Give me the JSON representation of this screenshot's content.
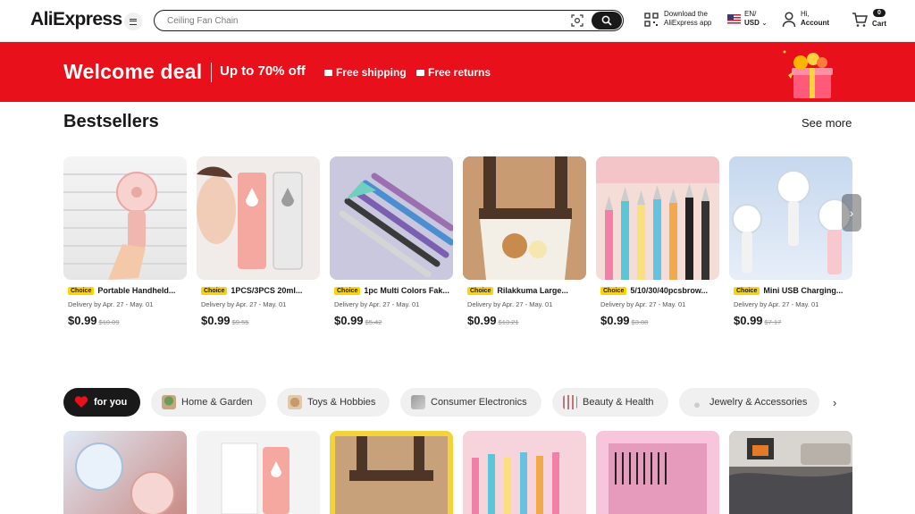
{
  "header": {
    "logo": "AliExpress",
    "search_placeholder": "Ceiling Fan Chain",
    "app_line1": "Download the",
    "app_line2": "AliExpress app",
    "lang_line1": "EN/",
    "lang_line2": "USD",
    "account_line1": "Hi,",
    "account_line2": "Account",
    "cart_count": "0",
    "cart_label": "Cart"
  },
  "banner": {
    "title": "Welcome deal",
    "subtitle": "Up to 70% off",
    "free_shipping": "Free shipping",
    "free_returns": "Free returns"
  },
  "bestsellers": {
    "title": "Bestsellers",
    "see_more": "See more",
    "products": [
      {
        "badge": "Choice",
        "title": "Portable Handheld...",
        "delivery": "Delivery by Apr. 27 - May. 01",
        "price": "$0.99",
        "old_price": "$10.09"
      },
      {
        "badge": "Choice",
        "title": "1PCS/3PCS 20ml...",
        "delivery": "Delivery by Apr. 27 - May. 01",
        "price": "$0.99",
        "old_price": "$9.55"
      },
      {
        "badge": "Choice",
        "title": "1pc Multi Colors Fak...",
        "delivery": "Delivery by Apr. 27 - May. 01",
        "price": "$0.99",
        "old_price": "$5.42"
      },
      {
        "badge": "Choice",
        "title": "Rilakkuma Large...",
        "delivery": "Delivery by Apr. 27 - May. 01",
        "price": "$0.99",
        "old_price": "$13.21"
      },
      {
        "badge": "Choice",
        "title": "5/10/30/40pcsbrow...",
        "delivery": "Delivery by Apr. 27 - May. 01",
        "price": "$0.99",
        "old_price": "$3.88"
      },
      {
        "badge": "Choice",
        "title": "Mini USB Charging...",
        "delivery": "Delivery by Apr. 27 - May. 01",
        "price": "$0.99",
        "old_price": "$7.17"
      }
    ]
  },
  "categories": {
    "tabs": [
      {
        "label": "for you"
      },
      {
        "label": "Home & Garden"
      },
      {
        "label": "Toys & Hobbies"
      },
      {
        "label": "Consumer Electronics"
      },
      {
        "label": "Beauty & Health"
      },
      {
        "label": "Jewelry & Accessories"
      }
    ]
  },
  "colors": {
    "brand_red": "#e8101b",
    "choice_yellow": "#fdd400",
    "dark": "#191919"
  }
}
